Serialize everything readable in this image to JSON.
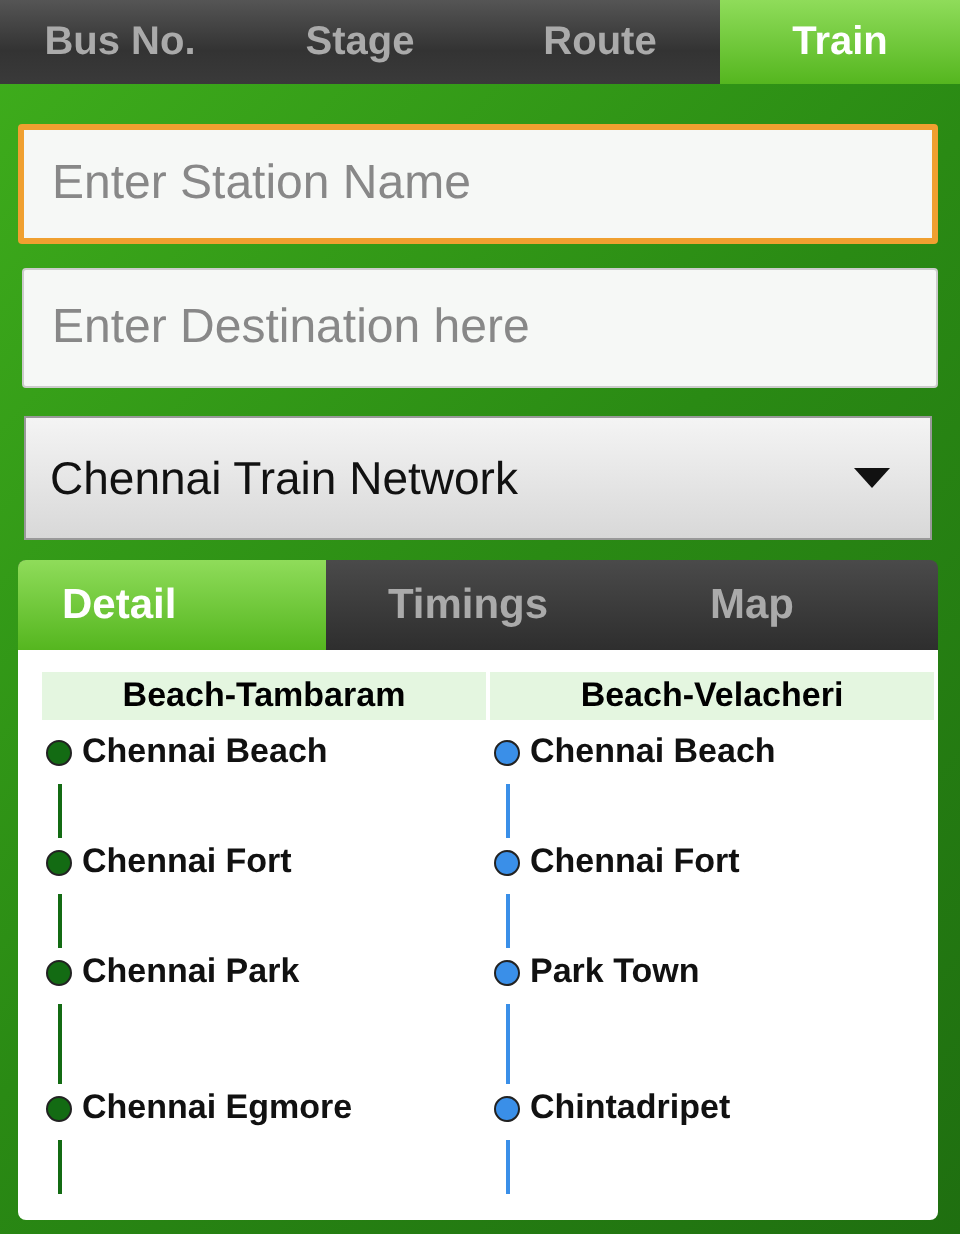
{
  "tabs": [
    {
      "label": "Bus No.",
      "selected": false
    },
    {
      "label": "Stage",
      "selected": false
    },
    {
      "label": "Route",
      "selected": false
    },
    {
      "label": "Train",
      "selected": true
    }
  ],
  "station_field": {
    "placeholder": "Enter Station Name",
    "focused": true
  },
  "destination_field": {
    "placeholder": "Enter Destination here",
    "focused": false
  },
  "network_dropdown": {
    "value": "Chennai Train Network"
  },
  "detail_tabs": [
    {
      "label": "Detail",
      "selected": true
    },
    {
      "label": "Timings",
      "selected": false
    },
    {
      "label": "Map",
      "selected": false
    }
  ],
  "lines": [
    {
      "name": "Beach-Tambaram",
      "color": "#136b13",
      "stations": [
        "Chennai Beach",
        "Chennai Fort",
        "Chennai Park",
        "Chennai Egmore"
      ]
    },
    {
      "name": "Beach-Velacheri",
      "color": "#3a8fe8",
      "stations": [
        "Chennai Beach",
        "Chennai Fort",
        "Park Town",
        "Chintadripet"
      ]
    }
  ]
}
